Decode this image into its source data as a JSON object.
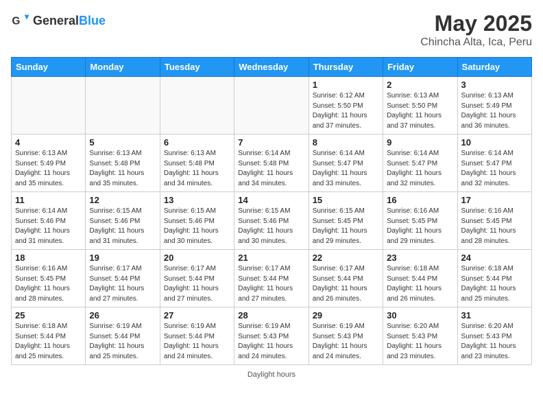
{
  "header": {
    "logo_general": "General",
    "logo_blue": "Blue",
    "month_title": "May 2025",
    "location": "Chincha Alta, Ica, Peru"
  },
  "weekdays": [
    "Sunday",
    "Monday",
    "Tuesday",
    "Wednesday",
    "Thursday",
    "Friday",
    "Saturday"
  ],
  "weeks": [
    [
      {
        "day": "",
        "info": ""
      },
      {
        "day": "",
        "info": ""
      },
      {
        "day": "",
        "info": ""
      },
      {
        "day": "",
        "info": ""
      },
      {
        "day": "1",
        "info": "Sunrise: 6:12 AM\nSunset: 5:50 PM\nDaylight: 11 hours and 37 minutes."
      },
      {
        "day": "2",
        "info": "Sunrise: 6:13 AM\nSunset: 5:50 PM\nDaylight: 11 hours and 37 minutes."
      },
      {
        "day": "3",
        "info": "Sunrise: 6:13 AM\nSunset: 5:49 PM\nDaylight: 11 hours and 36 minutes."
      }
    ],
    [
      {
        "day": "4",
        "info": "Sunrise: 6:13 AM\nSunset: 5:49 PM\nDaylight: 11 hours and 35 minutes."
      },
      {
        "day": "5",
        "info": "Sunrise: 6:13 AM\nSunset: 5:48 PM\nDaylight: 11 hours and 35 minutes."
      },
      {
        "day": "6",
        "info": "Sunrise: 6:13 AM\nSunset: 5:48 PM\nDaylight: 11 hours and 34 minutes."
      },
      {
        "day": "7",
        "info": "Sunrise: 6:14 AM\nSunset: 5:48 PM\nDaylight: 11 hours and 34 minutes."
      },
      {
        "day": "8",
        "info": "Sunrise: 6:14 AM\nSunset: 5:47 PM\nDaylight: 11 hours and 33 minutes."
      },
      {
        "day": "9",
        "info": "Sunrise: 6:14 AM\nSunset: 5:47 PM\nDaylight: 11 hours and 32 minutes."
      },
      {
        "day": "10",
        "info": "Sunrise: 6:14 AM\nSunset: 5:47 PM\nDaylight: 11 hours and 32 minutes."
      }
    ],
    [
      {
        "day": "11",
        "info": "Sunrise: 6:14 AM\nSunset: 5:46 PM\nDaylight: 11 hours and 31 minutes."
      },
      {
        "day": "12",
        "info": "Sunrise: 6:15 AM\nSunset: 5:46 PM\nDaylight: 11 hours and 31 minutes."
      },
      {
        "day": "13",
        "info": "Sunrise: 6:15 AM\nSunset: 5:46 PM\nDaylight: 11 hours and 30 minutes."
      },
      {
        "day": "14",
        "info": "Sunrise: 6:15 AM\nSunset: 5:46 PM\nDaylight: 11 hours and 30 minutes."
      },
      {
        "day": "15",
        "info": "Sunrise: 6:15 AM\nSunset: 5:45 PM\nDaylight: 11 hours and 29 minutes."
      },
      {
        "day": "16",
        "info": "Sunrise: 6:16 AM\nSunset: 5:45 PM\nDaylight: 11 hours and 29 minutes."
      },
      {
        "day": "17",
        "info": "Sunrise: 6:16 AM\nSunset: 5:45 PM\nDaylight: 11 hours and 28 minutes."
      }
    ],
    [
      {
        "day": "18",
        "info": "Sunrise: 6:16 AM\nSunset: 5:45 PM\nDaylight: 11 hours and 28 minutes."
      },
      {
        "day": "19",
        "info": "Sunrise: 6:17 AM\nSunset: 5:44 PM\nDaylight: 11 hours and 27 minutes."
      },
      {
        "day": "20",
        "info": "Sunrise: 6:17 AM\nSunset: 5:44 PM\nDaylight: 11 hours and 27 minutes."
      },
      {
        "day": "21",
        "info": "Sunrise: 6:17 AM\nSunset: 5:44 PM\nDaylight: 11 hours and 27 minutes."
      },
      {
        "day": "22",
        "info": "Sunrise: 6:17 AM\nSunset: 5:44 PM\nDaylight: 11 hours and 26 minutes."
      },
      {
        "day": "23",
        "info": "Sunrise: 6:18 AM\nSunset: 5:44 PM\nDaylight: 11 hours and 26 minutes."
      },
      {
        "day": "24",
        "info": "Sunrise: 6:18 AM\nSunset: 5:44 PM\nDaylight: 11 hours and 25 minutes."
      }
    ],
    [
      {
        "day": "25",
        "info": "Sunrise: 6:18 AM\nSunset: 5:44 PM\nDaylight: 11 hours and 25 minutes."
      },
      {
        "day": "26",
        "info": "Sunrise: 6:19 AM\nSunset: 5:44 PM\nDaylight: 11 hours and 25 minutes."
      },
      {
        "day": "27",
        "info": "Sunrise: 6:19 AM\nSunset: 5:44 PM\nDaylight: 11 hours and 24 minutes."
      },
      {
        "day": "28",
        "info": "Sunrise: 6:19 AM\nSunset: 5:43 PM\nDaylight: 11 hours and 24 minutes."
      },
      {
        "day": "29",
        "info": "Sunrise: 6:19 AM\nSunset: 5:43 PM\nDaylight: 11 hours and 24 minutes."
      },
      {
        "day": "30",
        "info": "Sunrise: 6:20 AM\nSunset: 5:43 PM\nDaylight: 11 hours and 23 minutes."
      },
      {
        "day": "31",
        "info": "Sunrise: 6:20 AM\nSunset: 5:43 PM\nDaylight: 11 hours and 23 minutes."
      }
    ]
  ],
  "footer": {
    "note": "Daylight hours"
  }
}
